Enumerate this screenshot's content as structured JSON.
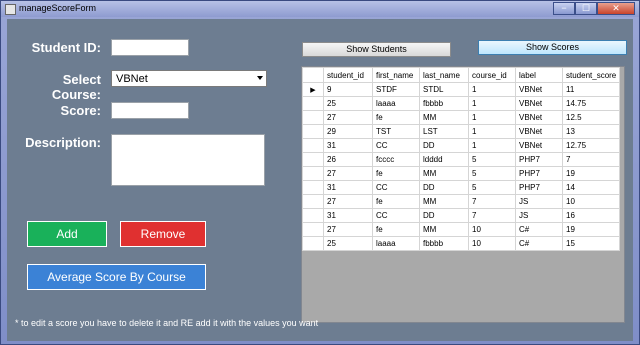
{
  "window": {
    "title": "manageScoreForm",
    "min": "−",
    "max": "☐",
    "close": "✕"
  },
  "form": {
    "student_id_label": "Student ID:",
    "student_id_value": "",
    "course_label": "Select Course:",
    "course_value": "VBNet",
    "score_label": "Score:",
    "score_value": "",
    "description_label": "Description:",
    "description_value": ""
  },
  "buttons": {
    "add": "Add",
    "remove": "Remove",
    "average": "Average Score By Course",
    "show_students": "Show Students",
    "show_scores": "Show Scores"
  },
  "colors": {
    "add_bg": "#19b15a",
    "remove_bg": "#e03030",
    "average_bg": "#3b82d6"
  },
  "grid": {
    "columns": [
      "student_id",
      "first_name",
      "last_name",
      "course_id",
      "label",
      "student_score"
    ],
    "current_row_marker": "▶",
    "rows": [
      [
        "9",
        "STDF",
        "STDL",
        "1",
        "VBNet",
        "11"
      ],
      [
        "25",
        "laaaa",
        "fbbbb",
        "1",
        "VBNet",
        "14.75"
      ],
      [
        "27",
        "fe",
        "MM",
        "1",
        "VBNet",
        "12.5"
      ],
      [
        "29",
        "TST",
        "LST",
        "1",
        "VBNet",
        "13"
      ],
      [
        "31",
        "CC",
        "DD",
        "1",
        "VBNet",
        "12.75"
      ],
      [
        "26",
        "fcccc",
        "ldddd",
        "5",
        "PHP7",
        "7"
      ],
      [
        "27",
        "fe",
        "MM",
        "5",
        "PHP7",
        "19"
      ],
      [
        "31",
        "CC",
        "DD",
        "5",
        "PHP7",
        "14"
      ],
      [
        "27",
        "fe",
        "MM",
        "7",
        "JS",
        "10"
      ],
      [
        "31",
        "CC",
        "DD",
        "7",
        "JS",
        "16"
      ],
      [
        "27",
        "fe",
        "MM",
        "10",
        "C#",
        "19"
      ],
      [
        "25",
        "laaaa",
        "fbbbb",
        "10",
        "C#",
        "15"
      ]
    ]
  },
  "footer_note": "* to edit a score you have to delete it and RE add it with the values you want"
}
